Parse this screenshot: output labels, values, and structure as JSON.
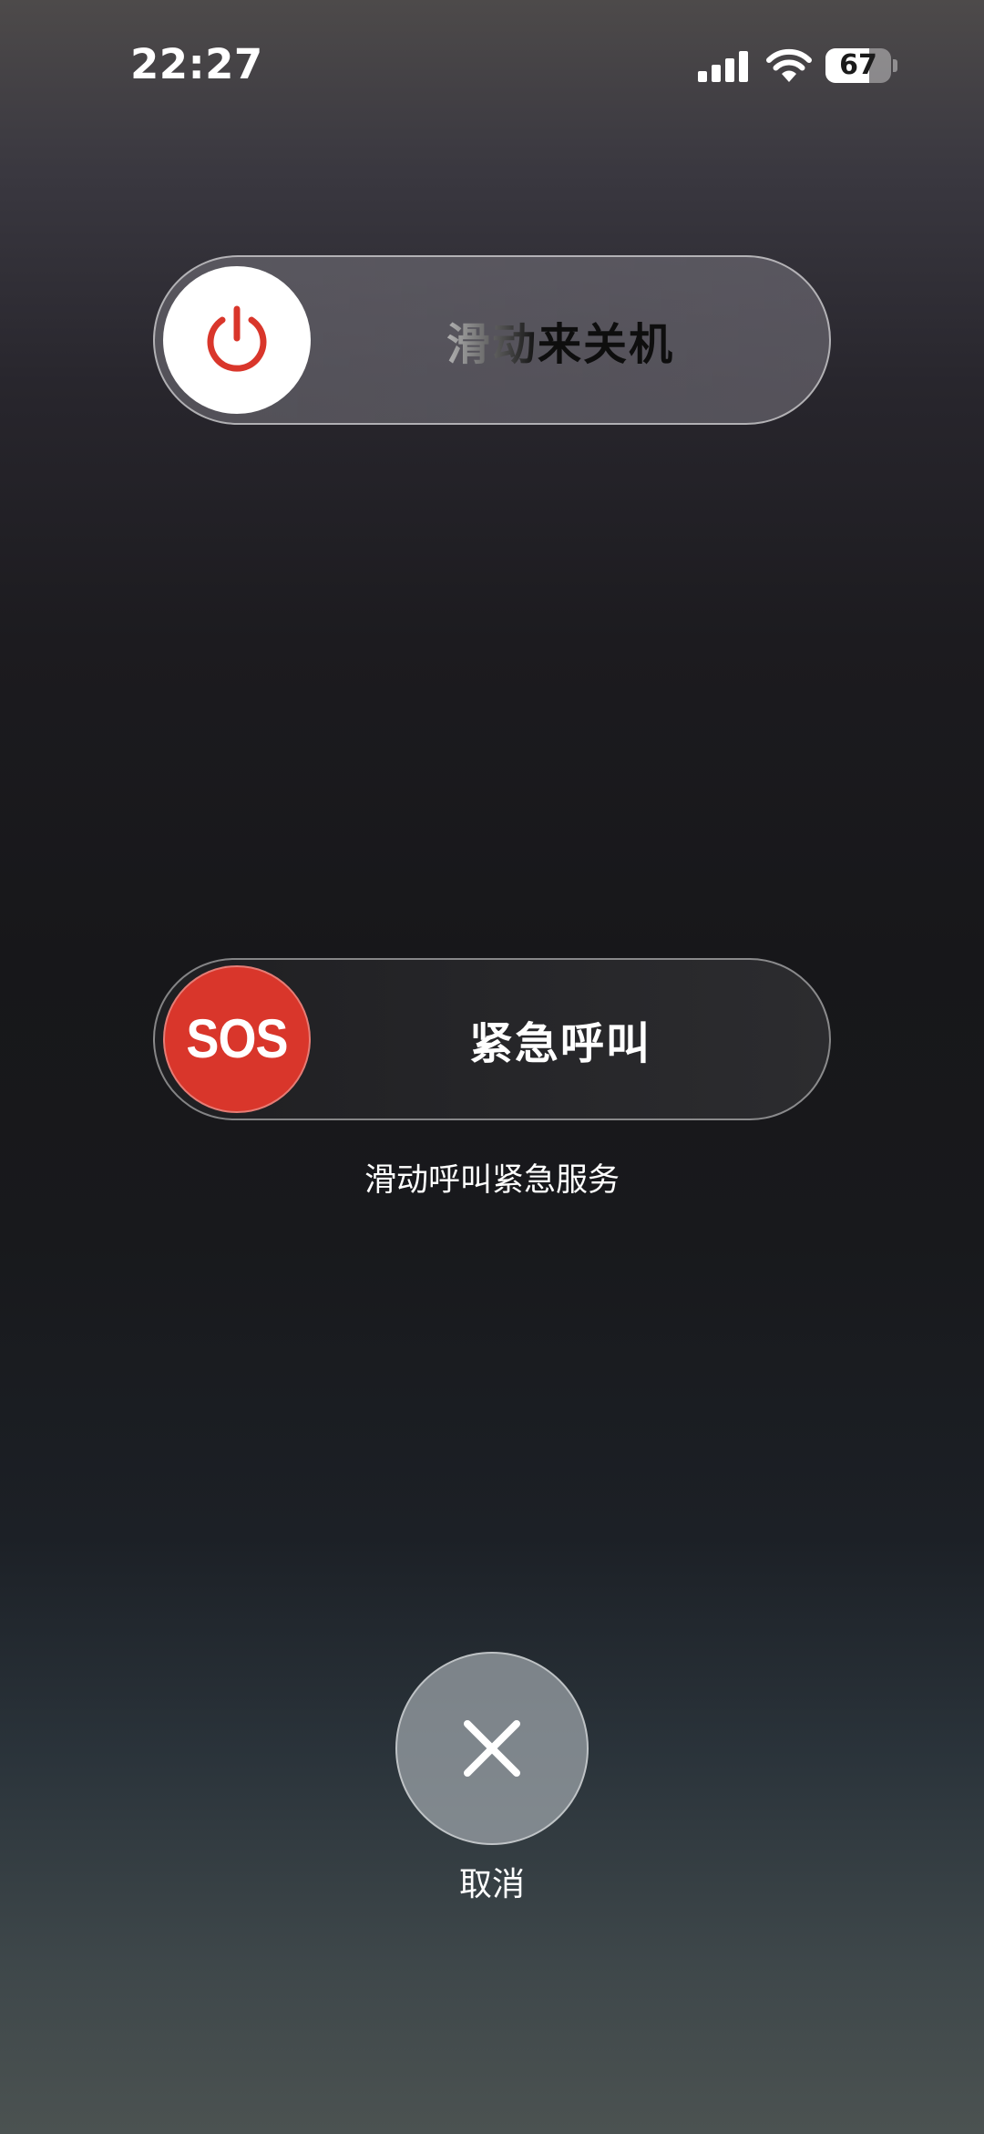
{
  "status_bar": {
    "time": "22:27",
    "battery_percent": "67",
    "battery_level": 0.67,
    "signal_bars": 4,
    "icons": [
      "cellular-signal-icon",
      "wifi-icon",
      "battery-icon"
    ]
  },
  "power_off": {
    "label": "滑动来关机",
    "knob_icon": "power-icon",
    "icon_color": "#d9362b"
  },
  "emergency_sos": {
    "knob_text": "SOS",
    "label": "紧急呼叫",
    "hint": "滑动呼叫紧急服务",
    "knob_color": "#d9362b"
  },
  "cancel": {
    "icon": "close-icon",
    "label": "取消"
  }
}
